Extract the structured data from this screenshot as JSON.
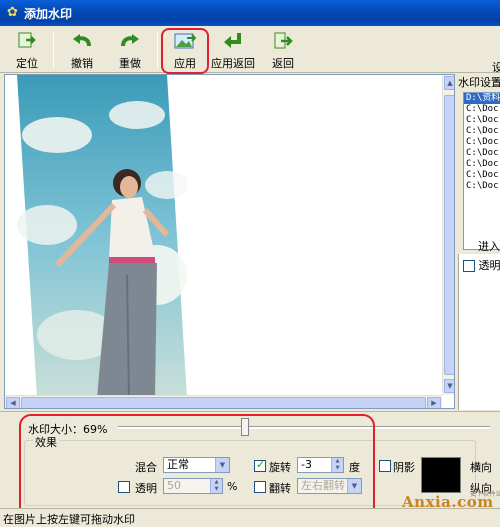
{
  "window": {
    "title": "添加水印",
    "icon": "star-icon"
  },
  "toolbar": {
    "buttons": [
      {
        "label": "定位",
        "icon": "locate-icon"
      },
      {
        "label": "撤销",
        "icon": "undo-icon"
      },
      {
        "label": "重做",
        "icon": "redo-icon"
      },
      {
        "label": "应用",
        "icon": "apply-icon"
      },
      {
        "label": "应用返回",
        "icon": "apply-return-icon"
      },
      {
        "label": "返回",
        "icon": "return-icon"
      }
    ],
    "truncated_right_label": "设"
  },
  "right_panel": {
    "title": "水印设置",
    "list_items": [
      "D:\\资料",
      "C:\\Doc",
      "C:\\Doc",
      "C:\\Doc",
      "C:\\Doc",
      "C:\\Doc",
      "C:\\Doc",
      "C:\\Doc",
      "C:\\Doc"
    ],
    "selected_index": 0,
    "import_label": "进入",
    "transparent_label": "透明"
  },
  "bottom": {
    "size_label": "水印大小：",
    "size_value": "69%",
    "size_fraction": 0.69,
    "effects_title": "效果",
    "blend_label": "混合",
    "blend_value": "正常",
    "opacity_label": "透明",
    "opacity_value": "50",
    "opacity_unit": "%",
    "rotate_label": "旋转",
    "rotate_value": "-3",
    "rotate_unit": "度",
    "rotate_checked": true,
    "flip_label": "翻转",
    "flip_value": "左右翻转",
    "flip_checked": false,
    "shadow_label": "阴影",
    "shadow_checked": false,
    "shadow_color": "#000000",
    "horizontal_label": "横向",
    "vertical_label": "纵向"
  },
  "status": {
    "text": "在图片上按左键可拖动水印"
  },
  "watermark": {
    "brand": "Anxia.com",
    "sub": "安下软件站"
  }
}
